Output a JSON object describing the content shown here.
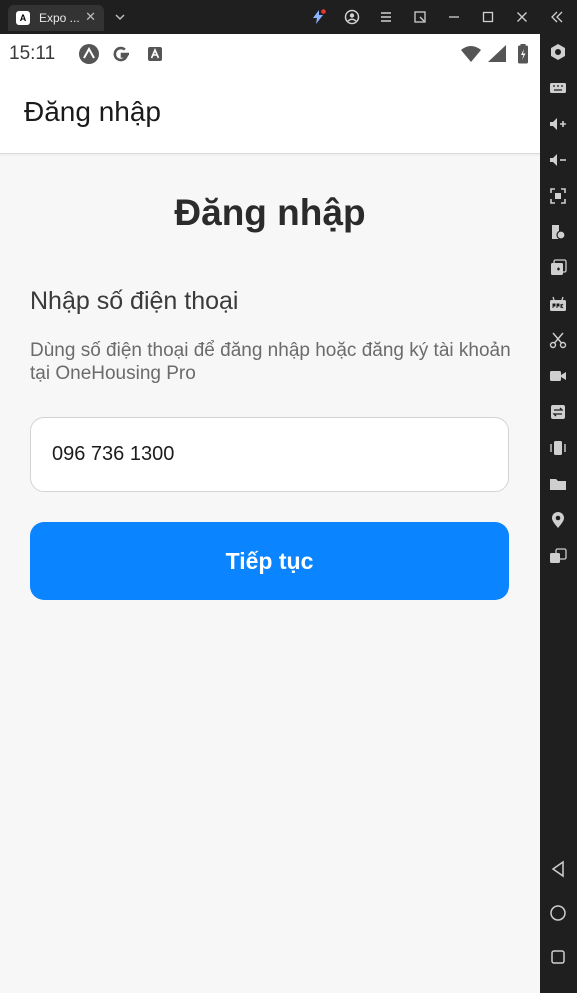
{
  "window": {
    "tab_title": "Expo ...",
    "tab_favicon_glyph": "A",
    "tab_close_icon": "close-icon",
    "colors": {
      "chrome_bg": "#1f1f1f",
      "tab_bg": "#333333",
      "accent_icon": "#8ab4ff",
      "notification_dot": "#e53935"
    }
  },
  "status_bar": {
    "time": "15:11",
    "app_icons": [
      "expo-icon",
      "google-icon",
      "accessibility-icon"
    ],
    "indicators": [
      "wifi-icon",
      "signal-icon",
      "battery-icon"
    ]
  },
  "app_bar": {
    "title": "Đăng nhập"
  },
  "login": {
    "heading": "Đăng nhập",
    "section_title": "Nhập số điện thoại",
    "description": "Dùng số điện thoại để đăng nhập hoặc đăng ký tài khoản tại OneHousing Pro",
    "phone_value": "096 736 1300",
    "continue_label": "Tiếp tục",
    "colors": {
      "primary": "#0a84ff",
      "background": "#f7f7f7"
    }
  },
  "emulator_toolbar": {
    "tools": [
      "settings-icon",
      "keyboard-icon",
      "volume-up-icon",
      "volume-down-icon",
      "screenshot-icon",
      "rotate-icon",
      "add-window-icon",
      "apk-icon",
      "cut-icon",
      "video-icon",
      "swap-icon",
      "shake-icon",
      "folder-icon",
      "location-icon",
      "multi-window-icon"
    ],
    "nav": [
      "back-icon",
      "home-icon",
      "recents-icon"
    ]
  }
}
